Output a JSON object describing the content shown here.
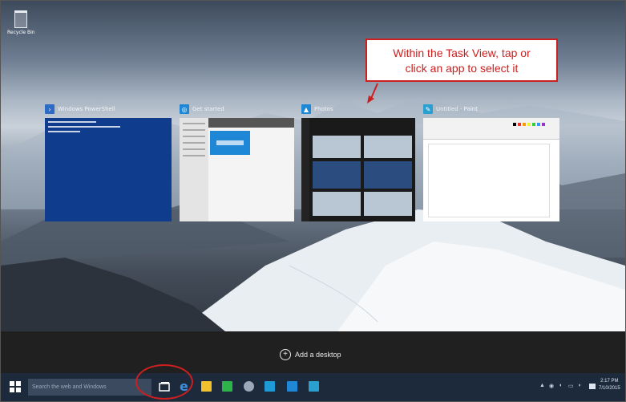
{
  "desktop": {
    "recycle_bin_label": "Recycle Bin"
  },
  "callout": {
    "line1": "Within the Task View, tap or",
    "line2": "click an app to select it",
    "color": "#cc1f1f"
  },
  "task_view": {
    "windows": [
      {
        "title": "Windows PowerShell",
        "icon": "powershell-icon",
        "accent": "#2e6bc5"
      },
      {
        "title": "Get started",
        "icon": "get-started-icon",
        "accent": "#1e88d6"
      },
      {
        "title": "Photos",
        "icon": "photos-icon",
        "accent": "#1e88d6"
      },
      {
        "title": "Untitled - Paint",
        "icon": "paint-icon",
        "accent": "#2aa0d0"
      }
    ],
    "add_desktop_label": "Add a desktop"
  },
  "taskbar": {
    "search_placeholder": "Search the web and Windows",
    "apps": [
      {
        "name": "task-view-icon",
        "color": "#ffffff"
      },
      {
        "name": "edge-icon",
        "color": "#3a8fe0"
      },
      {
        "name": "file-explorer-icon",
        "color": "#f2c12e"
      },
      {
        "name": "store-icon",
        "color": "#2db34a"
      },
      {
        "name": "settings-icon",
        "color": "#9aa8ba"
      },
      {
        "name": "calculator-icon",
        "color": "#1e9ad6"
      },
      {
        "name": "photos-icon",
        "color": "#1e88d6"
      },
      {
        "name": "paint-icon",
        "color": "#2aa0d0"
      }
    ],
    "clock_time": "2:17 PM",
    "clock_date": "7/10/2015"
  }
}
